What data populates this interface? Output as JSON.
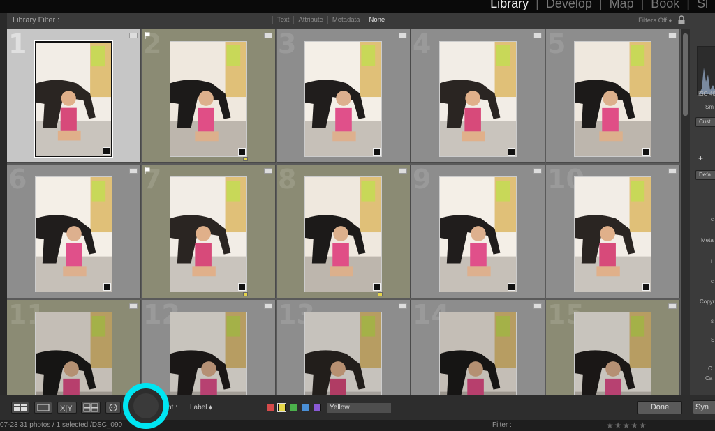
{
  "modules": {
    "items": [
      {
        "label": "Library",
        "active": true
      },
      {
        "label": "Develop",
        "active": false
      },
      {
        "label": "Map",
        "active": false
      },
      {
        "label": "Book",
        "active": false
      },
      {
        "label": "Sl",
        "active": false
      }
    ]
  },
  "filter_bar": {
    "title": "Library Filter :",
    "tabs": [
      "Text",
      "Attribute",
      "Metadata",
      "None"
    ],
    "active_tab": "None",
    "filters_status": "Filters Off ⬧"
  },
  "grid": {
    "cells": [
      {
        "number": "1",
        "label_color": "none",
        "selected": true,
        "flag": false
      },
      {
        "number": "2",
        "label_color": "yellow",
        "selected": false,
        "flag": true
      },
      {
        "number": "3",
        "label_color": "none",
        "selected": false,
        "flag": false
      },
      {
        "number": "4",
        "label_color": "none",
        "selected": false,
        "flag": false
      },
      {
        "number": "5",
        "label_color": "none",
        "selected": false,
        "flag": false
      },
      {
        "number": "6",
        "label_color": "none",
        "selected": false,
        "flag": false
      },
      {
        "number": "7",
        "label_color": "yellow",
        "selected": false,
        "flag": true
      },
      {
        "number": "8",
        "label_color": "yellow",
        "selected": false,
        "flag": false
      },
      {
        "number": "9",
        "label_color": "none",
        "selected": false,
        "flag": false
      },
      {
        "number": "10",
        "label_color": "none",
        "selected": false,
        "flag": false
      },
      {
        "number": "11",
        "label_color": "yellow",
        "selected": false,
        "flag": false
      },
      {
        "number": "12",
        "label_color": "none",
        "selected": false,
        "flag": false
      },
      {
        "number": "13",
        "label_color": "none",
        "selected": false,
        "flag": false
      },
      {
        "number": "14",
        "label_color": "none",
        "selected": false,
        "flag": false
      },
      {
        "number": "15",
        "label_color": "yellow",
        "selected": false,
        "flag": false
      }
    ]
  },
  "right_panel": {
    "iso_text": "ISO 40",
    "sm_text": "Sm",
    "custom_btn": "Cust",
    "plus": "+",
    "default_btn": "Defa",
    "meta_text": "Meta",
    "copy_text": "Copyr",
    "letters": [
      "c",
      "i",
      "c",
      "s",
      "S",
      "C",
      "Ca"
    ]
  },
  "toolbar": {
    "sort_label": "nt :",
    "sort_value": "Label ⬧",
    "label_value": "Yellow",
    "done_label": "Done",
    "sync_label": "Syn",
    "swatches": [
      "#d64b4b",
      "#e6d84a",
      "#4bb04b",
      "#4a8fd6",
      "#8a5ad6"
    ]
  },
  "status": {
    "text": "07-23    31 photos / 1 selected /DSC_090",
    "filter_label": "Filter :",
    "stars": "★★★★★"
  },
  "colors": {
    "yellow_label": "#8b8b74",
    "gray_cell": "#8d8d8d",
    "selected_cell": "#c6c6c6",
    "cursor_highlight": "#00e5f2"
  }
}
